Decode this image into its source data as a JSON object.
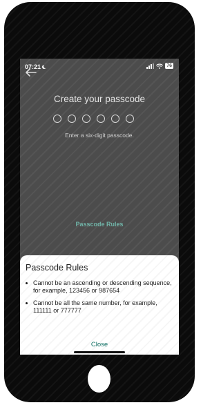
{
  "status_bar": {
    "time": "07:21",
    "battery": "76"
  },
  "icons": [
    "moon-icon",
    "signal-icon",
    "wifi-icon",
    "battery-icon",
    "back-arrow-icon",
    "bullet-icon"
  ],
  "screen": {
    "title": "Create your passcode",
    "dot_count": 6,
    "hint": "Enter a six-digit passcode.",
    "rules_link": "Passcode Rules"
  },
  "sheet": {
    "title": "Passcode Rules",
    "rules": [
      "Cannot be an ascending or descending sequence, for example, 123456 or 987654",
      "Cannot be all the same number, for example, 111111 or 777777"
    ],
    "close_label": "Close"
  },
  "colors": {
    "phone_body": "#0b0b0b",
    "overlay": "#4c4c4c",
    "link": "#6fb3a7",
    "close": "#0f6f63"
  }
}
